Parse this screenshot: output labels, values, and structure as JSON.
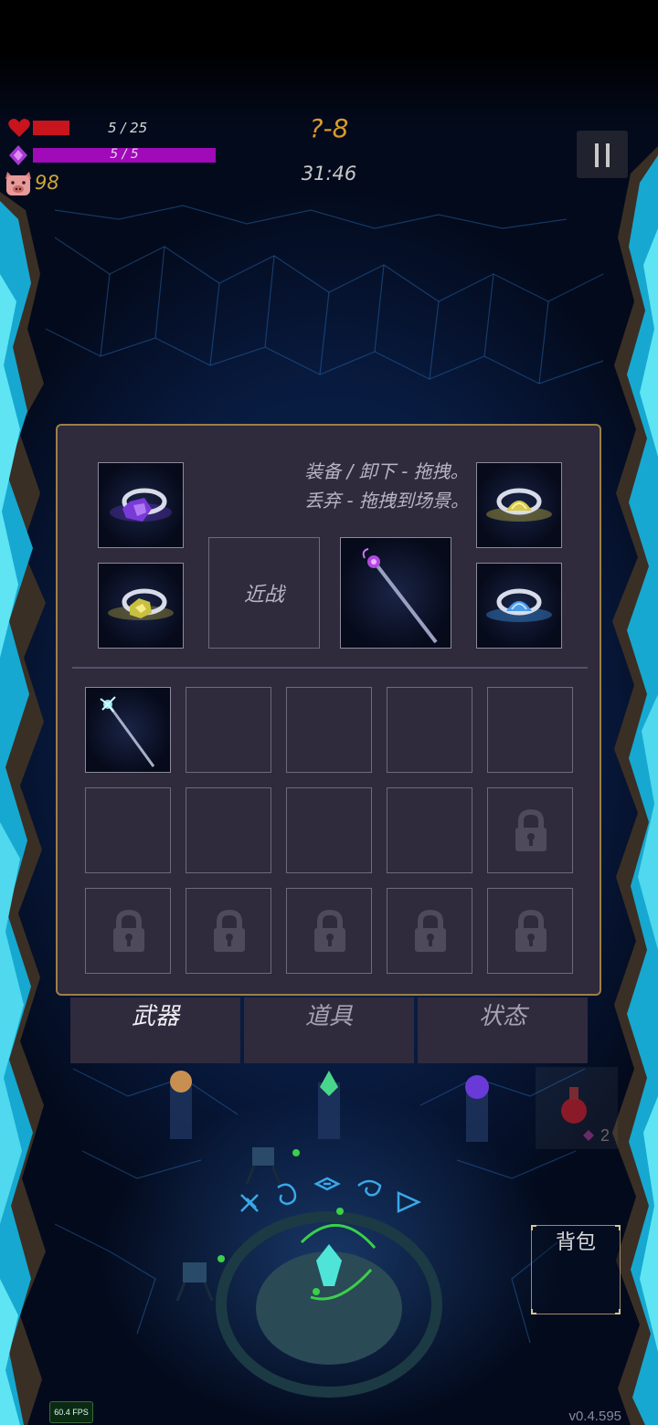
{
  "hud": {
    "hp_text": "5 / 25",
    "hp_fraction": 0.2,
    "mana_text": "5 / 5",
    "mana_fraction": 1.0,
    "coins": "98",
    "level": "?-8",
    "timer": "31:46"
  },
  "inventory": {
    "hint_line1": "装备 / 卸下 - 拖拽。",
    "hint_line2": "丢弃 - 拖拽到场景。",
    "melee_label": "近战",
    "equipped_rings": [
      "purple-gem-ring",
      "yellow-gem-ring",
      "yellow-gem-ring",
      "blue-gem-ring"
    ],
    "equipped_weapon": "purple-orb-staff",
    "bag_grid": {
      "rows": 3,
      "cols": 5,
      "filled": [
        "cyan-crystal-staff"
      ],
      "unlocked_slots": 9,
      "locked_slots": 6
    }
  },
  "tabs": [
    {
      "label": "武器",
      "active": true
    },
    {
      "label": "道具",
      "active": false
    },
    {
      "label": "状态",
      "active": false
    }
  ],
  "scene": {
    "potion_count": "2",
    "bag_button_label": "背包"
  },
  "debug": {
    "fps": "60.4 FPS",
    "version": "v0.4.595"
  },
  "colors": {
    "hp": "#c8141c",
    "mana": "#a00ab8",
    "gold": "#d89a2a",
    "panel_bg": "#2f2a3c",
    "panel_border": "#9b8048",
    "crystal": "#1fb8d8"
  }
}
